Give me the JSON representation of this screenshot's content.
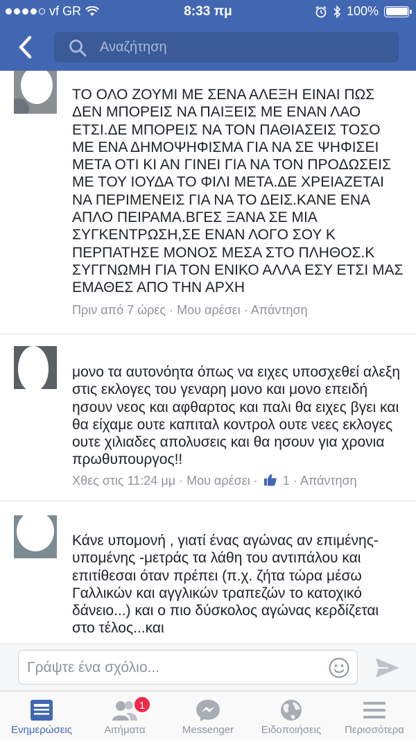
{
  "status_bar": {
    "carrier": "vf GR",
    "time": "8:33 πμ",
    "battery": "100%"
  },
  "search": {
    "placeholder": "Αναζήτηση"
  },
  "comments": [
    {
      "text": "ΤΟ ΟΛΟ ΖΟΥΜΙ ΜΕ ΣΕΝΑ ΑΛΕΞΗ ΕΙΝΑΙ ΠΩΣ ΔΕΝ ΜΠΟΡΕΙΣ ΝΑ ΠΑΙΞΕΙΣ ΜΕ ΕΝΑΝ ΛΑΟ ΕΤΣΙ.ΔΕ ΜΠΟΡΕΙΣ ΝΑ ΤΟΝ ΠΑΘΙΑΣΕΙΣ ΤΟΣΟ ΜΕ ΕΝΑ ΔΗΜΟΨΗΦΙΣΜΑ ΓΙΑ ΝΑ ΣΕ ΨΗΦΙΣΕΙ ΜΕΤΑ ΟΤΙ ΚΙ ΑΝ ΓΙΝΕΙ ΓΙΑ ΝΑ ΤΟΝ ΠΡΟΔΩΣΕΙΣ ΜΕ ΤΟΥ ΙΟΥΔΑ ΤΟ ΦΙΛΙ ΜΕΤΑ.ΔΕ ΧΡΕΙΑΖΕΤΑΙ ΝΑ ΠΕΡΙΜΕΝΕΙΣ ΓΙΑ ΝΑ ΤΟ ΔΕΙΣ.ΚΑΝΕ ΕΝΑ ΑΠΛΟ ΠΕΙΡΑΜΑ.ΒΓΕΣ ΞΑΝΑ ΣΕ ΜΙΑ ΣΥΓΚΕΝΤΡΩΣΗ,ΣΕ ΕΝΑΝ ΛΟΓΟ ΣΟΥ Κ ΠΕΡΠΑΤΗΣΕ ΜΟΝΟΣ ΜΕΣΑ ΣΤΟ ΠΛΗΘΟΣ.Κ ΣΥΓΓΝΩΜΗ ΓΙΑ ΤΟΝ ΕΝΙΚΟ ΑΛΛΑ ΕΣΥ ΕΤΣΙ ΜΑΣ ΕΜΑΘΕΣ ΑΠΟ ΤΗΝ ΑΡΧΗ",
      "time": "Πριν από 7 ώρες",
      "like": "Μου αρέσει",
      "reply": "Απάντηση"
    },
    {
      "text": "μονο τα αυτονόητα όπως να ειχες υποσχεθεί αλεξη στις εκλογες του γεναρη μονο και μονο επειδή ησουν νεος και αφθαρτος  και παλι θα ειχες βγει και θα είχαμε ουτε καπιταλ κοντρολ ουτε νεες εκλογες ουτε χιλιαδες απολυσεις και θα ησουν για χρονια πρωθυπουργος!!",
      "time": "Χθες στις 11:24 μμ",
      "like": "Μου αρέσει",
      "like_count": "1",
      "reply": "Απάντηση"
    },
    {
      "text": "Κάνε υπομονή , γιατί ένας αγώνας αν επιμένης-υπομένης -μετράς τα λάθη του αντιπάλου και επιτίθεσαι όταν πρέπει (π.χ. ζήτα τώρα μέσω Γαλλικών και αγγλικών τραπεζών το κατοχικό δάνειο...) και ο πιο δύσκολος αγώνας κερδίζεται στο τέλος...και"
    }
  ],
  "composer": {
    "placeholder": "Γράψτε ένα σχόλιο..."
  },
  "tabs": [
    {
      "label": "Ενημερώσεις",
      "icon": "news-feed-icon",
      "active": true
    },
    {
      "label": "Αιτήματα",
      "icon": "friend-requests-icon",
      "badge": "1"
    },
    {
      "label": "Messenger",
      "icon": "messenger-icon"
    },
    {
      "label": "Ειδοποιήσεις",
      "icon": "globe-icon"
    },
    {
      "label": "Περισσότερα",
      "icon": "menu-icon"
    }
  ],
  "colors": {
    "header": "#4267b2",
    "accent": "#4267b2",
    "badge": "#f02849"
  }
}
